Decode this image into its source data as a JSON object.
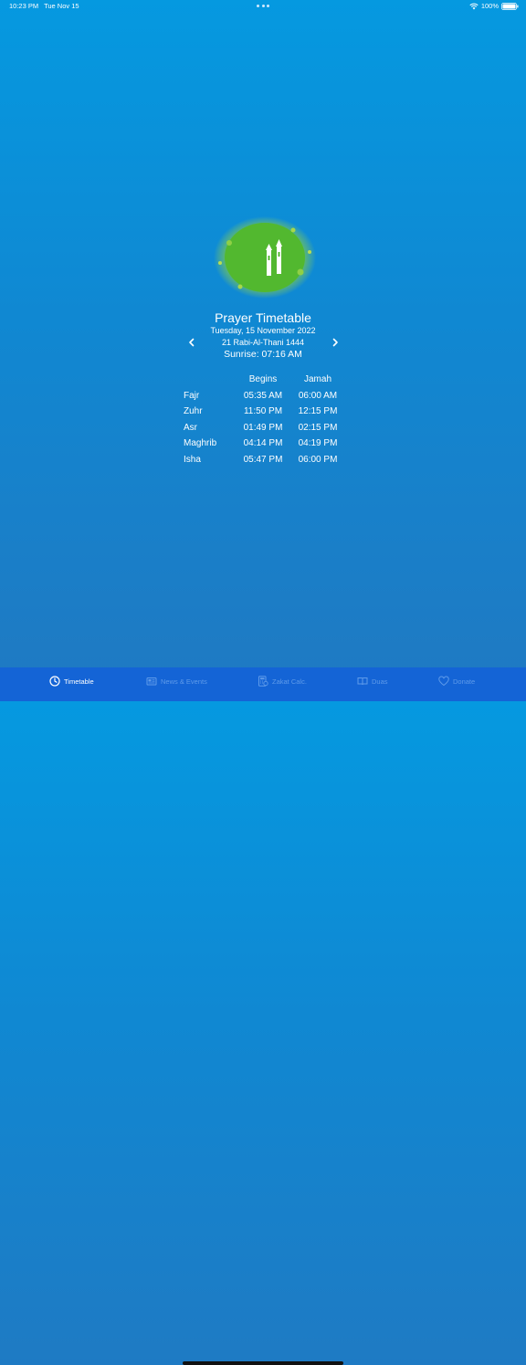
{
  "status_bar": {
    "time": "10:23 PM",
    "date": "Tue Nov 15",
    "battery": "100%"
  },
  "header": {
    "title": "Prayer Timetable",
    "gregorian_date": "Tuesday, 15 November 2022",
    "hijri_date": "21 Rabi-Al-Thani 1444",
    "sunrise": "Sunrise: 07:16 AM"
  },
  "timetable": {
    "columns": [
      "",
      "Begins",
      "Jamah"
    ],
    "rows": [
      {
        "name": "Fajr",
        "begins": "05:35 AM",
        "jamah": "06:00 AM"
      },
      {
        "name": "Zuhr",
        "begins": "11:50 PM",
        "jamah": "12:15 PM"
      },
      {
        "name": "Asr",
        "begins": "01:49 PM",
        "jamah": "02:15 PM"
      },
      {
        "name": "Maghrib",
        "begins": "04:14 PM",
        "jamah": "04:19 PM"
      },
      {
        "name": "Isha",
        "begins": "05:47 PM",
        "jamah": "06:00 PM"
      }
    ]
  },
  "tabs": [
    {
      "label": "Timetable",
      "icon": "clock-icon",
      "active": true
    },
    {
      "label": "News & Events",
      "icon": "newspaper-icon",
      "active": false
    },
    {
      "label": "Zakat Calc.",
      "icon": "calculator-icon",
      "active": false
    },
    {
      "label": "Duas",
      "icon": "book-icon",
      "active": false
    },
    {
      "label": "Donate",
      "icon": "heart-icon",
      "active": false
    }
  ],
  "colors": {
    "background_top": "#0599e0",
    "background_bottom": "#2079c2",
    "tab_bar": "#1464d6",
    "tab_inactive": "#5f9bea",
    "logo_green": "#5cc03a"
  }
}
